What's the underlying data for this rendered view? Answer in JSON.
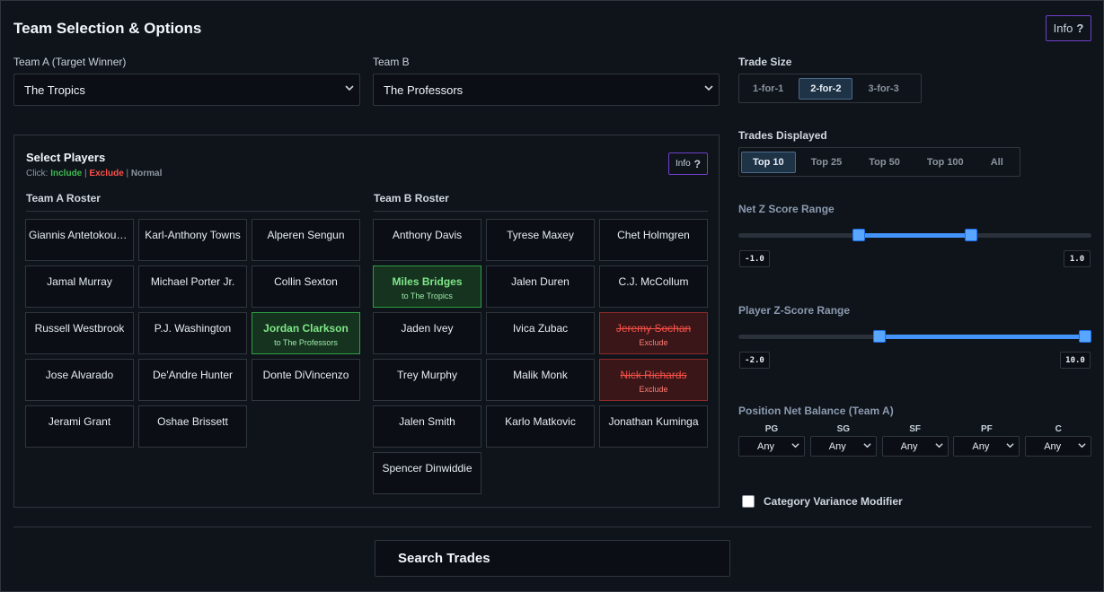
{
  "header": {
    "title": "Team Selection & Options",
    "info_label": "Info",
    "info_glyph": "?"
  },
  "team_a": {
    "label": "Team A (Target Winner)",
    "value": "The Tropics"
  },
  "team_b": {
    "label": "Team B",
    "value": "The Professors"
  },
  "trade_size": {
    "label": "Trade Size",
    "options": [
      "1-for-1",
      "2-for-2",
      "3-for-3"
    ],
    "selected": "2-for-2"
  },
  "trades_displayed": {
    "label": "Trades Displayed",
    "options": [
      "Top 10",
      "Top 25",
      "Top 50",
      "Top 100",
      "All"
    ],
    "selected": "Top 10"
  },
  "players_panel": {
    "title": "Select Players",
    "hint_prefix": "Click: ",
    "hint_include": "Include",
    "hint_sep1": " | ",
    "hint_exclude": "Exclude",
    "hint_sep2": " | ",
    "hint_normal": "Normal",
    "info_label": "Info",
    "info_glyph": "?"
  },
  "team_a_roster": {
    "title": "Team A Roster",
    "players": [
      {
        "name": "Giannis Antetokounmpo",
        "state": "normal",
        "note": ""
      },
      {
        "name": "Karl-Anthony Towns",
        "state": "normal",
        "note": ""
      },
      {
        "name": "Alperen Sengun",
        "state": "normal",
        "note": ""
      },
      {
        "name": "Jamal Murray",
        "state": "normal",
        "note": ""
      },
      {
        "name": "Michael Porter Jr.",
        "state": "normal",
        "note": ""
      },
      {
        "name": "Collin Sexton",
        "state": "normal",
        "note": ""
      },
      {
        "name": "Russell Westbrook",
        "state": "normal",
        "note": ""
      },
      {
        "name": "P.J. Washington",
        "state": "normal",
        "note": ""
      },
      {
        "name": "Jordan Clarkson",
        "state": "include",
        "note": "to The Professors"
      },
      {
        "name": "Jose Alvarado",
        "state": "normal",
        "note": ""
      },
      {
        "name": "De'Andre Hunter",
        "state": "normal",
        "note": ""
      },
      {
        "name": "Donte DiVincenzo",
        "state": "normal",
        "note": ""
      },
      {
        "name": "Jerami Grant",
        "state": "normal",
        "note": ""
      },
      {
        "name": "Oshae Brissett",
        "state": "normal",
        "note": ""
      }
    ]
  },
  "team_b_roster": {
    "title": "Team B Roster",
    "players": [
      {
        "name": "Anthony Davis",
        "state": "normal",
        "note": ""
      },
      {
        "name": "Tyrese Maxey",
        "state": "normal",
        "note": ""
      },
      {
        "name": "Chet Holmgren",
        "state": "normal",
        "note": ""
      },
      {
        "name": "Miles Bridges",
        "state": "include",
        "note": "to The Tropics"
      },
      {
        "name": "Jalen Duren",
        "state": "normal",
        "note": ""
      },
      {
        "name": "C.J. McCollum",
        "state": "normal",
        "note": ""
      },
      {
        "name": "Jaden Ivey",
        "state": "normal",
        "note": ""
      },
      {
        "name": "Ivica Zubac",
        "state": "normal",
        "note": ""
      },
      {
        "name": "Jeremy Sochan",
        "state": "exclude",
        "note": "Exclude"
      },
      {
        "name": "Trey Murphy",
        "state": "normal",
        "note": ""
      },
      {
        "name": "Malik Monk",
        "state": "normal",
        "note": ""
      },
      {
        "name": "Nick Richards",
        "state": "exclude",
        "note": "Exclude"
      },
      {
        "name": "Jalen Smith",
        "state": "normal",
        "note": ""
      },
      {
        "name": "Karlo Matkovic",
        "state": "normal",
        "note": ""
      },
      {
        "name": "Jonathan Kuminga",
        "state": "normal",
        "note": ""
      },
      {
        "name": "Spencer Dinwiddie",
        "state": "normal",
        "note": ""
      }
    ]
  },
  "net_z": {
    "label": "Net Z Score Range",
    "min_label": "-1.0",
    "max_label": "1.0",
    "low_fraction": 0.34,
    "high_fraction": 0.66
  },
  "player_z": {
    "label": "Player Z-Score Range",
    "min_label": "-2.0",
    "max_label": "10.0",
    "low_fraction": 0.4,
    "high_fraction": 1.0
  },
  "position_balance": {
    "label": "Position Net Balance (Team A)",
    "positions": [
      {
        "pos": "PG",
        "value": "Any"
      },
      {
        "pos": "SG",
        "value": "Any"
      },
      {
        "pos": "SF",
        "value": "Any"
      },
      {
        "pos": "PF",
        "value": "Any"
      },
      {
        "pos": "C",
        "value": "Any"
      }
    ]
  },
  "variance": {
    "label": "Category Variance Modifier",
    "checked": false
  },
  "search": {
    "label": "Search Trades"
  },
  "colors": {
    "accent": "#4493f8",
    "include": "#3fb950",
    "exclude": "#f85149",
    "info_border": "#6e40c9"
  }
}
